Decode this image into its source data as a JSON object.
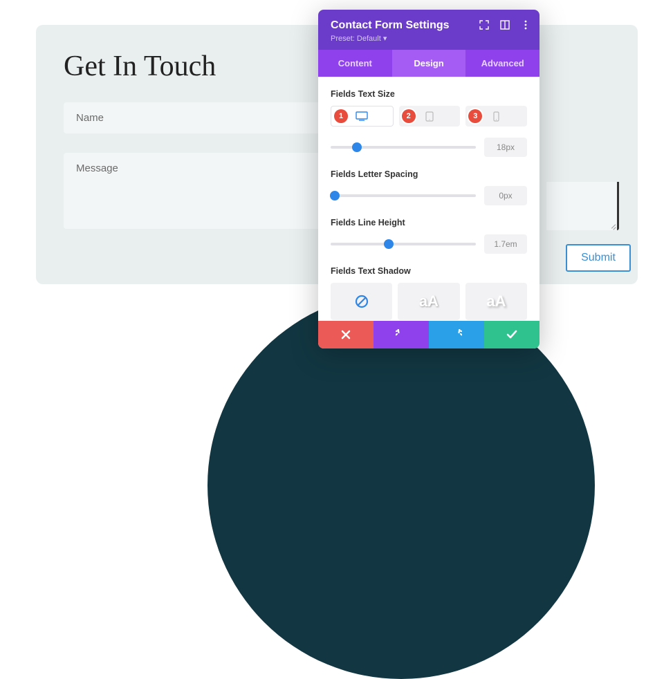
{
  "page": {
    "heading": "Get In Touch",
    "name_placeholder": "Name",
    "message_placeholder": "Message",
    "submit_label": "Submit"
  },
  "panel": {
    "title": "Contact Form Settings",
    "preset": "Preset: Default ▾",
    "tabs": {
      "content": "Content",
      "design": "Design",
      "advanced": "Advanced"
    },
    "sections": {
      "text_size": "Fields Text Size",
      "letter_spacing": "Fields Letter Spacing",
      "line_height": "Fields Line Height",
      "text_shadow": "Fields Text Shadow"
    },
    "devices": {
      "b1": "1",
      "b2": "2",
      "b3": "3"
    },
    "values": {
      "text_size": "18px",
      "letter_spacing": "0px",
      "line_height": "1.7em"
    },
    "shadow_sample": "aA"
  }
}
